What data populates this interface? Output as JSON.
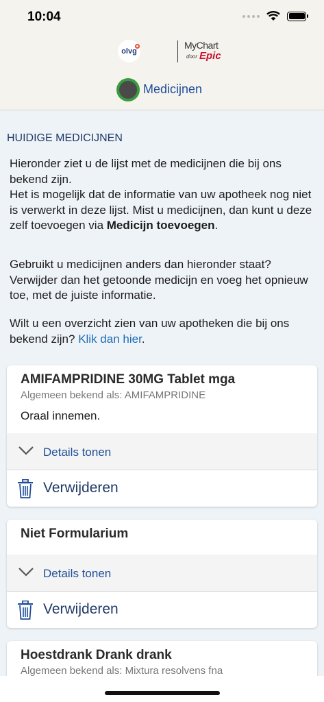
{
  "status_bar": {
    "time": "10:04"
  },
  "header": {
    "hospital_logo_text": "olvg",
    "mychart_logo": {
      "brand": "MyChart",
      "by": "door",
      "epic": "Epic"
    },
    "page_title": "Medicijnen"
  },
  "section": {
    "title": "HUIDIGE MEDICIJNEN",
    "intro_p1_a": "Hieronder ziet u de lijst met de medicijnen die bij ons bekend zijn.",
    "intro_p1_b": "Het is mogelijk dat de informatie van uw apotheek nog niet is verwerkt in deze lijst. Mist u medicijnen, dan kunt u deze zelf toevoegen via ",
    "intro_p1_bold": "Medicijn toevoegen",
    "intro_p1_end": ".",
    "intro_p2": "Gebruikt u medicijnen anders dan hieronder staat? Verwijder dan het getoonde medicijn en voeg het opnieuw toe, met de juiste informatie.",
    "intro_p3": "Wilt u een overzicht zien van uw apotheken die bij ons bekend zijn? ",
    "intro_p3_link": "Klik dan hier",
    "intro_p3_end": "."
  },
  "medications": [
    {
      "name": "AMIFAMPRIDINE 30MG Tablet mga",
      "generic": "Algemeen bekend als: AMIFAMPRIDINE",
      "instructions": "Oraal innemen.",
      "details_label": "Details tonen",
      "remove_label": "Verwijderen"
    },
    {
      "name": "Niet Formularium",
      "details_label": "Details tonen",
      "remove_label": "Verwijderen"
    },
    {
      "name": "Hoestdrank Drank drank",
      "generic": "Algemeen bekend als: Mixtura resolvens fna"
    }
  ]
}
